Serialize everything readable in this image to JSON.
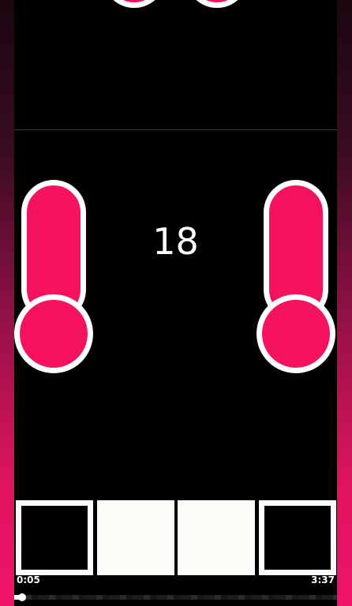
{
  "score": "18",
  "player": {
    "elapsed": "0:05",
    "duration": "3:37",
    "progress": 0.023
  },
  "colors": {
    "accent": "#f5135f",
    "outline": "#ffffff",
    "background": "#000000",
    "tile_light": "#fbfdf9"
  },
  "tiles": [
    "dark",
    "light",
    "light",
    "dark"
  ]
}
